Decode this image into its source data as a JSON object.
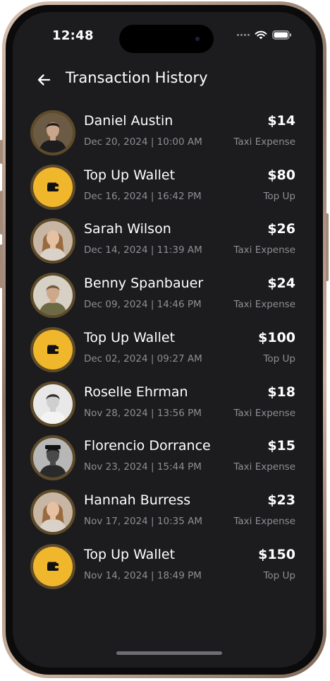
{
  "status_bar": {
    "time": "12:48"
  },
  "header": {
    "title": "Transaction History",
    "back_icon": "arrow-left-icon"
  },
  "colors": {
    "background": "#1c1c1e",
    "accent_wallet": "#f1b72c",
    "avatar_ring": "#5e4b2a",
    "text_primary": "#ffffff",
    "text_secondary": "#8e8e93"
  },
  "transactions": [
    {
      "name": "Daniel Austin",
      "date": "Dec 20, 2024 | 10:00 AM",
      "amount": "$14",
      "type": "Taxi Expense",
      "avatar": "person-photo",
      "avatar_style": "dark-jacket"
    },
    {
      "name": "Top Up Wallet",
      "date": "Dec 16, 2024 | 16:42 PM",
      "amount": "$80",
      "type": "Top Up",
      "avatar": "wallet-icon"
    },
    {
      "name": "Sarah Wilson",
      "date": "Dec 14, 2024 | 11:39 AM",
      "amount": "$26",
      "type": "Taxi Expense",
      "avatar": "person-photo",
      "avatar_style": "woman-light"
    },
    {
      "name": "Benny Spanbauer",
      "date": "Dec 09, 2024 | 14:46 PM",
      "amount": "$24",
      "type": "Taxi Expense",
      "avatar": "person-photo",
      "avatar_style": "man-olive"
    },
    {
      "name": "Top Up Wallet",
      "date": "Dec 02, 2024 | 09:27 AM",
      "amount": "$100",
      "type": "Top Up",
      "avatar": "wallet-icon"
    },
    {
      "name": "Roselle Ehrman",
      "date": "Nov 28, 2024 | 13:56 PM",
      "amount": "$18",
      "type": "Taxi Expense",
      "avatar": "person-photo",
      "avatar_style": "man-bw"
    },
    {
      "name": "Florencio Dorrance",
      "date": "Nov 23, 2024 | 15:44 PM",
      "amount": "$15",
      "type": "Taxi Expense",
      "avatar": "person-photo",
      "avatar_style": "man-dark-hat"
    },
    {
      "name": "Hannah Burress",
      "date": "Nov 17, 2024 | 10:35 AM",
      "amount": "$23",
      "type": "Taxi Expense",
      "avatar": "person-photo",
      "avatar_style": "woman-light"
    },
    {
      "name": "Top Up Wallet",
      "date": "Nov 14, 2024 | 18:49 PM",
      "amount": "$150",
      "type": "Top Up",
      "avatar": "wallet-icon"
    }
  ]
}
